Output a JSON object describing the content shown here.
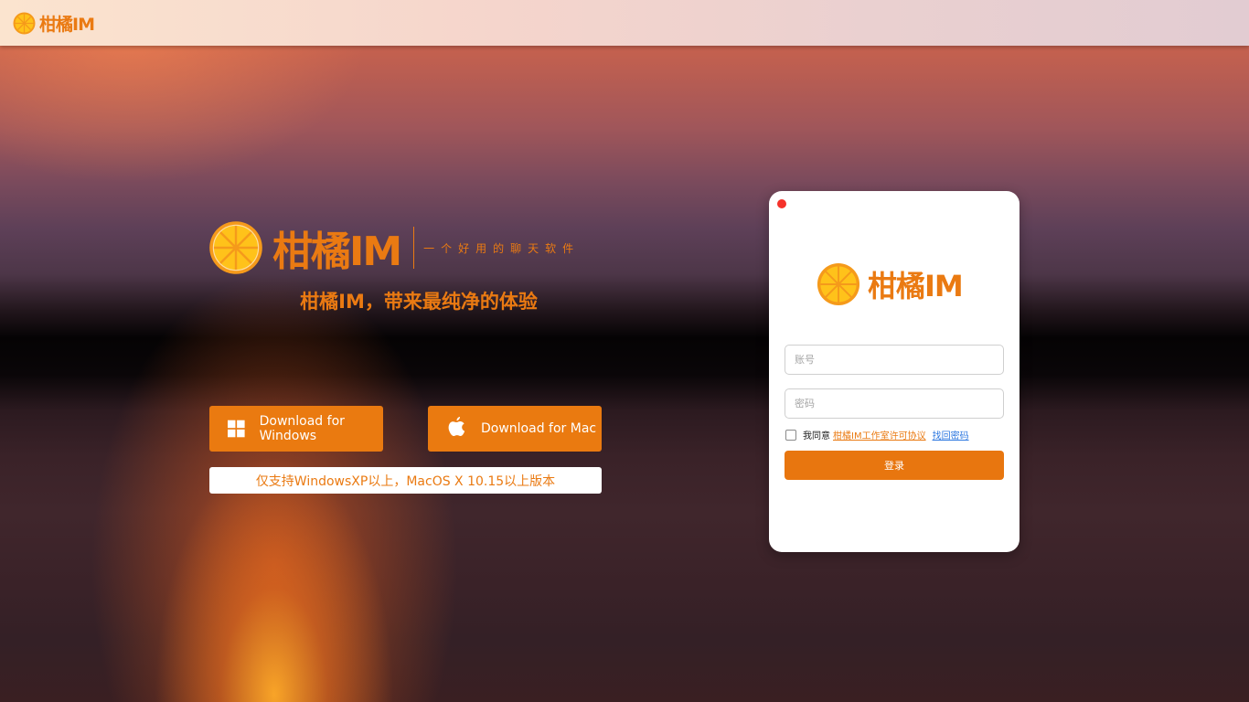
{
  "header": {
    "brand": "柑橘IM"
  },
  "hero": {
    "brand": "柑橘IM",
    "tagline": "一个好用的聊天软件",
    "slogan": "柑橘IM，带来最纯净的体验",
    "download_windows": "Download for Windows",
    "download_mac": "Download for Mac",
    "support_note": "仅支持WindowsXP以上，MacOS X 10.15以上版本"
  },
  "login": {
    "brand": "柑橘IM",
    "account_placeholder": "账号",
    "password_placeholder": "密码",
    "agree_text": "我同意",
    "license_link": "柑橘IM工作室许可协议",
    "forgot_link": "找回密码",
    "submit_label": "登录",
    "agree_checked": false
  },
  "colors": {
    "brand_orange": "#ea7a12",
    "link_blue": "#2f79e0",
    "close_red": "#f5322a"
  },
  "icons": [
    "orange-logo-icon",
    "windows-icon",
    "apple-icon",
    "close-dot-icon"
  ]
}
